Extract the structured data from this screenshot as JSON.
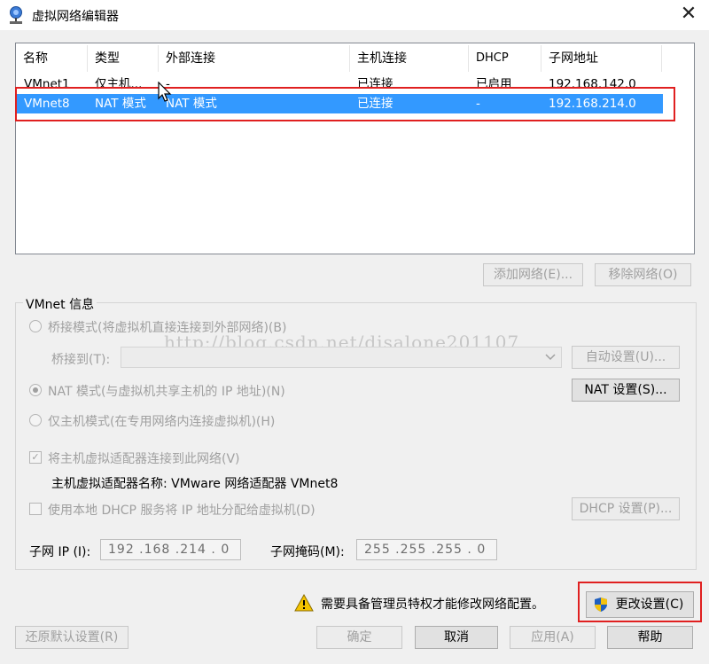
{
  "window": {
    "title": "虚拟网络编辑器",
    "close_glyph": "✕"
  },
  "table": {
    "columns": [
      "名称",
      "类型",
      "外部连接",
      "主机连接",
      "DHCP",
      "子网地址"
    ],
    "rows": [
      {
        "name": "VMnet1",
        "type": "仅主机...",
        "external": "-",
        "host": "已连接",
        "dhcp": "已启用",
        "subnet": "192.168.142.0",
        "selected": false
      },
      {
        "name": "VMnet8",
        "type": "NAT 模式",
        "external": "NAT 模式",
        "host": "已连接",
        "dhcp": "-",
        "subnet": "192.168.214.0",
        "selected": true
      }
    ]
  },
  "list_buttons": {
    "add": "添加网络(E)...",
    "remove": "移除网络(O)"
  },
  "vmnet_info": {
    "group_label": "VMnet 信息",
    "bridged_label": "桥接模式(将虚拟机直接连接到外部网络)(B)",
    "bridged_to_label": "桥接到(T):",
    "auto_settings": "自动设置(U)...",
    "nat_label": "NAT 模式(与虚拟机共享主机的 IP 地址)(N)",
    "nat_settings": "NAT 设置(S)...",
    "hostonly_label": "仅主机模式(在专用网络内连接虚拟机)(H)",
    "connect_adapter_label": "将主机虚拟适配器连接到此网络(V)",
    "adapter_name_label": "主机虚拟适配器名称: VMware 网络适配器 VMnet8",
    "dhcp_label": "使用本地 DHCP 服务将 IP 地址分配给虚拟机(D)",
    "dhcp_settings": "DHCP 设置(P)...",
    "subnet_ip_label": "子网 IP (I):",
    "subnet_ip_value": "192 .168 .214 . 0",
    "subnet_mask_label": "子网掩码(M):",
    "subnet_mask_value": "255 .255 .255 . 0"
  },
  "watermark": "http://blog.csdn.net/disalone201107",
  "admin_notice": "需要具备管理员特权才能修改网络配置。",
  "change_settings": "更改设置(C)",
  "footer": {
    "restore": "还原默认设置(R)",
    "ok": "确定",
    "cancel": "取消",
    "apply": "应用(A)",
    "help": "帮助"
  },
  "colors": {
    "selection": "#3399ff",
    "highlight_box": "#e02020"
  }
}
